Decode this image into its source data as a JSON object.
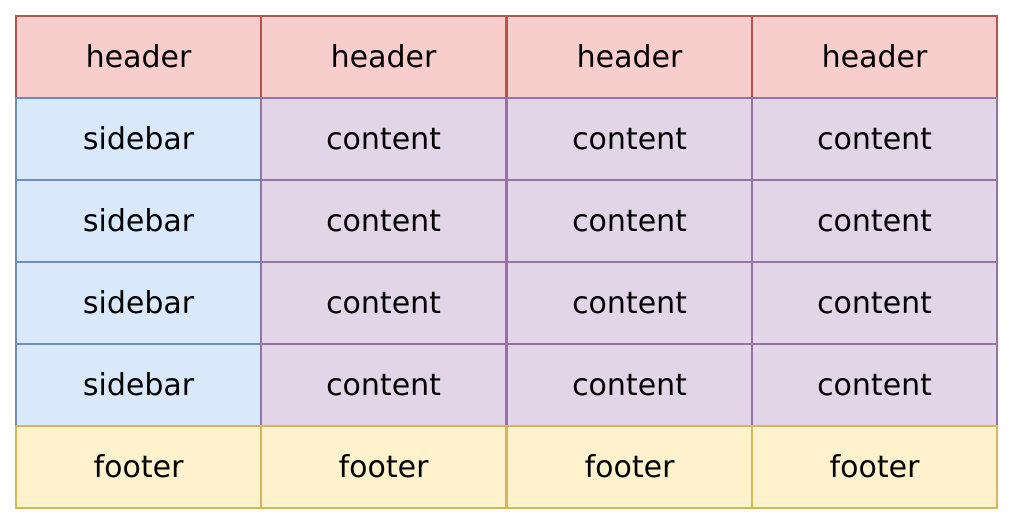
{
  "grid": {
    "rows": [
      {
        "type": "header",
        "cells": [
          "header",
          "header",
          "header",
          "header"
        ]
      },
      {
        "type": "sidebar-content",
        "cells": [
          "sidebar",
          "content",
          "content",
          "content"
        ]
      },
      {
        "type": "sidebar-content",
        "cells": [
          "sidebar",
          "content",
          "content",
          "content"
        ]
      },
      {
        "type": "sidebar-content",
        "cells": [
          "sidebar",
          "content",
          "content",
          "content"
        ]
      },
      {
        "type": "sidebar-content",
        "cells": [
          "sidebar",
          "content",
          "content",
          "content"
        ]
      },
      {
        "type": "footer",
        "cells": [
          "footer",
          "footer",
          "footer",
          "footer"
        ]
      }
    ]
  },
  "colors": {
    "header": {
      "fill": "#f8cecc",
      "stroke": "#b85450"
    },
    "sidebar": {
      "fill": "#dae8fc",
      "stroke": "#6c8ebf"
    },
    "content": {
      "fill": "#e1d5e7",
      "stroke": "#9673a6"
    },
    "footer": {
      "fill": "#fff2cc",
      "stroke": "#d6b656"
    }
  }
}
